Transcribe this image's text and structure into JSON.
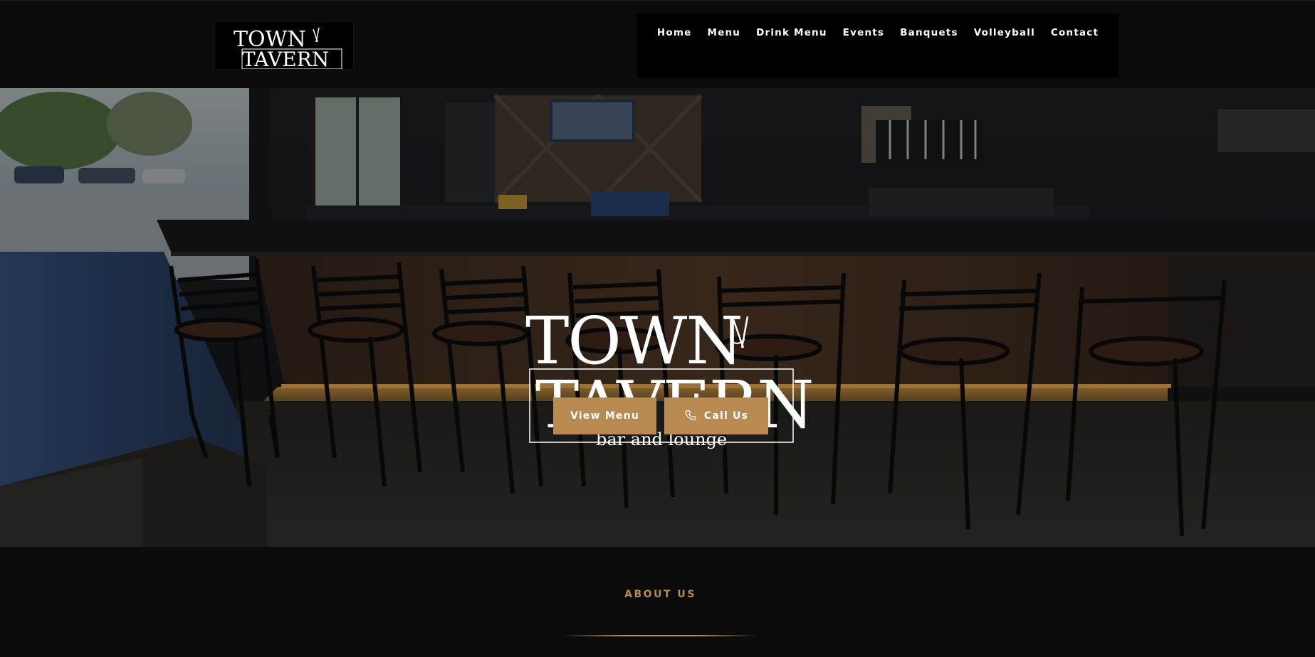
{
  "brand": {
    "logo_line1": "TOWN",
    "logo_line2": "TAVERN",
    "logo_tagline": "bar and lounge"
  },
  "nav": {
    "items": [
      "Home",
      "Menu",
      "Drink Menu",
      "Events",
      "Banquets",
      "Volleyball",
      "Contact"
    ]
  },
  "hero": {
    "buttons": {
      "view_menu": "View Menu",
      "call_us": "Call Us"
    },
    "phone_icon": "phone-icon"
  },
  "about": {
    "label": "ABOUT US"
  },
  "colors": {
    "background": "#0b0b0b",
    "nav_bg": "#000000",
    "accent": "#b78a52",
    "text": "#ffffff"
  }
}
